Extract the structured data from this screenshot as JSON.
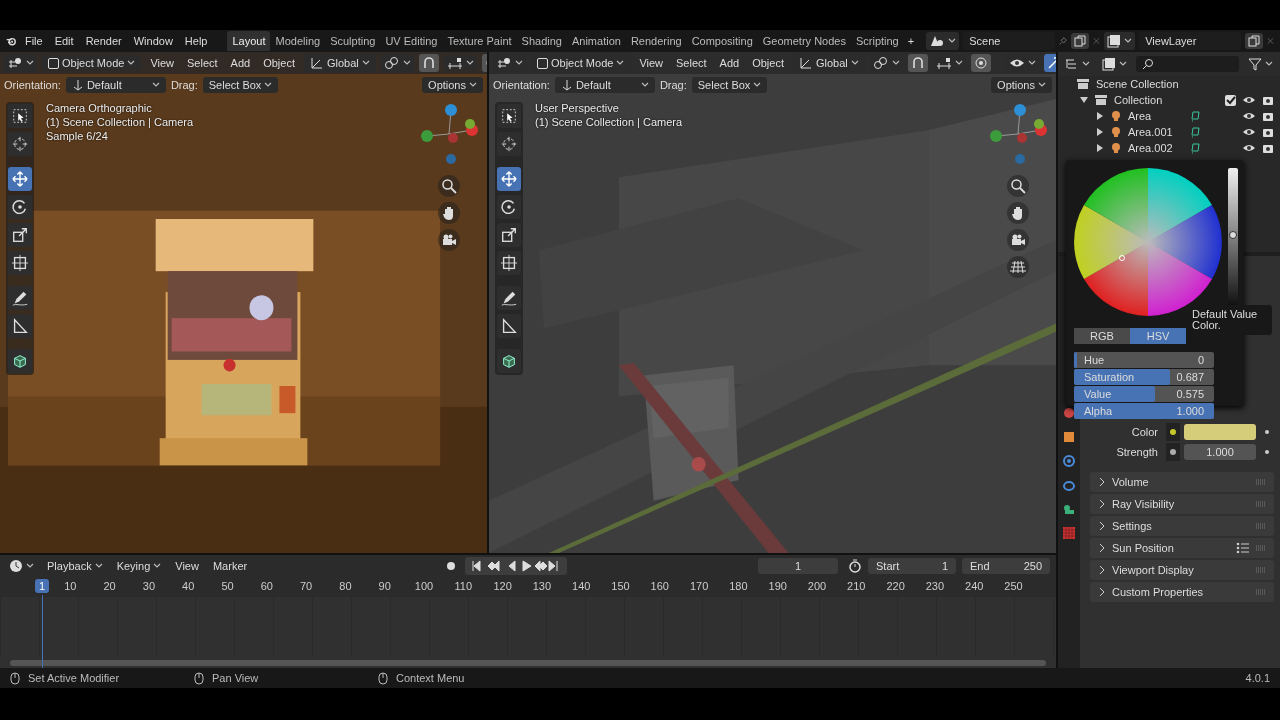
{
  "menu": [
    "File",
    "Edit",
    "Render",
    "Window",
    "Help"
  ],
  "workspaces": [
    {
      "label": "Layout",
      "selected": true
    },
    {
      "label": "Modeling",
      "selected": false
    },
    {
      "label": "Sculpting",
      "selected": false
    },
    {
      "label": "UV Editing",
      "selected": false
    },
    {
      "label": "Texture Paint",
      "selected": false
    },
    {
      "label": "Shading",
      "selected": false
    },
    {
      "label": "Animation",
      "selected": false
    },
    {
      "label": "Rendering",
      "selected": false
    },
    {
      "label": "Compositing",
      "selected": false
    },
    {
      "label": "Geometry Nodes",
      "selected": false
    },
    {
      "label": "Scripting",
      "selected": false
    }
  ],
  "add_workspace": "+",
  "scene": "Scene",
  "view_layer": "ViewLayer",
  "viewports": [
    {
      "kind": "render",
      "mode": "Object Mode",
      "menus": [
        "View",
        "Select",
        "Add",
        "Object"
      ],
      "transform": "Global",
      "orientation_label": "Orientation:",
      "orientation": "Default",
      "drag_label": "Drag:",
      "drag": "Select Box",
      "options": "Options",
      "overlay": [
        "Camera Orthographic",
        "(1) Scene Collection | Camera",
        "Sample 6/24"
      ],
      "tools": [
        {
          "kind": "select",
          "selected": false
        },
        {
          "kind": "cursor",
          "selected": false
        },
        {
          "kind": "move",
          "selected": true
        },
        {
          "kind": "rotate",
          "selected": false
        },
        {
          "kind": "scale",
          "selected": false
        },
        {
          "kind": "transform",
          "selected": false
        },
        {
          "kind": "annotate",
          "selected": false
        },
        {
          "kind": "measure",
          "selected": false
        },
        {
          "kind": "add-cube",
          "selected": false
        }
      ]
    },
    {
      "kind": "solid",
      "mode": "Object Mode",
      "menus": [
        "View",
        "Select",
        "Add",
        "Object"
      ],
      "transform": "Global",
      "orientation_label": "Orientation:",
      "orientation": "Default",
      "drag_label": "Drag:",
      "drag": "Select Box",
      "options": "Options",
      "overlay": [
        "User Perspective",
        "(1) Scene Collection | Camera"
      ],
      "tools": [
        {
          "kind": "select",
          "selected": false
        },
        {
          "kind": "cursor",
          "selected": false
        },
        {
          "kind": "move",
          "selected": true
        },
        {
          "kind": "rotate",
          "selected": false
        },
        {
          "kind": "scale",
          "selected": false
        },
        {
          "kind": "transform",
          "selected": false
        },
        {
          "kind": "annotate",
          "selected": false
        },
        {
          "kind": "measure",
          "selected": false
        },
        {
          "kind": "add-cube",
          "selected": false
        }
      ]
    }
  ],
  "outliner": {
    "root": "Scene Collection",
    "children": [
      {
        "label": "Collection",
        "expanded": true,
        "checked": true,
        "children": [
          {
            "label": "Area",
            "expanded": false
          },
          {
            "label": "Area.001",
            "expanded": false
          },
          {
            "label": "Area.002",
            "expanded": false
          }
        ]
      }
    ]
  },
  "color_picker": {
    "tabs": [
      {
        "label": "RGB",
        "selected": false
      },
      {
        "label": "HSV",
        "selected": true
      }
    ],
    "fields": [
      {
        "label": "Hue",
        "value": "0",
        "level": 0.02
      },
      {
        "label": "Saturation",
        "value": "0.687",
        "level": 0.687
      },
      {
        "label": "Value",
        "value": "0.575",
        "level": 0.575
      },
      {
        "label": "Alpha",
        "value": "1.000",
        "level": 1
      }
    ],
    "tooltip": "Default Value Color."
  },
  "properties": {
    "color_label": "Color",
    "color": "#d6cd7a",
    "strength_label": "Strength",
    "strength": "1.000",
    "panels": [
      "Volume",
      "Ray Visibility",
      "Settings",
      "Sun Position",
      "Viewport Display",
      "Custom Properties"
    ]
  },
  "timeline": {
    "menus": [
      "Playback",
      "Keying",
      "View",
      "Marker"
    ],
    "frame": "1",
    "start_label": "Start",
    "start": "1",
    "end_label": "End",
    "end": "250",
    "ruler": [
      "10",
      "20",
      "30",
      "40",
      "50",
      "60",
      "70",
      "80",
      "90",
      "100",
      "110",
      "120",
      "130",
      "140",
      "150",
      "160",
      "170",
      "180",
      "190",
      "200",
      "210",
      "220",
      "230",
      "240",
      "250"
    ],
    "current": "1"
  },
  "status": [
    "Set Active Modifier",
    "Pan View",
    "Context Menu"
  ],
  "version": "4.0.1"
}
